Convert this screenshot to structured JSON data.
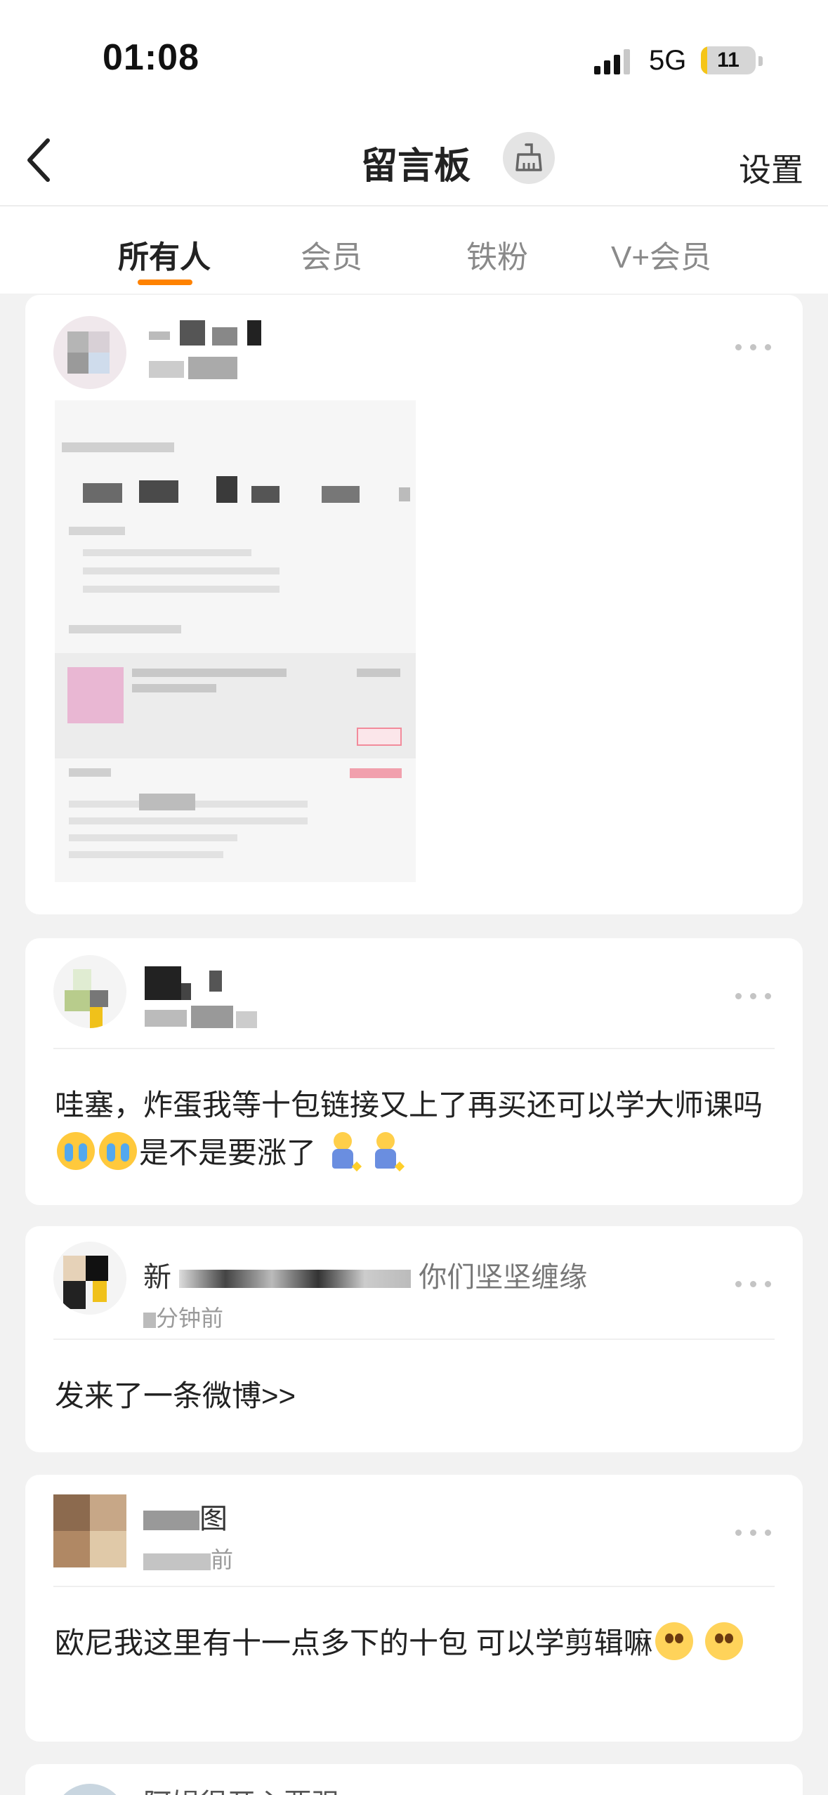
{
  "status_bar": {
    "time": "01:08",
    "network": "5G",
    "battery": "11",
    "battery_level": 0.11
  },
  "nav": {
    "title": "留言板",
    "settings_label": "设置",
    "back_icon": "chevron-left-icon",
    "broom_icon": "broom-icon"
  },
  "tabs": [
    {
      "label": "所有人",
      "active": true
    },
    {
      "label": "会员",
      "active": false
    },
    {
      "label": "铁粉",
      "active": false
    },
    {
      "label": "V+会员",
      "active": false
    }
  ],
  "colors": {
    "accent": "#ff8200",
    "background": "#f2f2f2",
    "card": "#ffffff"
  },
  "posts": [
    {
      "type": "image"
    },
    {
      "text": "哇塞，炸蛋我等十包链接又上了再买还可以学大师课吗",
      "text2": "是不是要涨了"
    },
    {
      "username_partial": "新",
      "username_tail": "你们坚坚缠缘",
      "time_partial": "分钟前",
      "text": "发来了一条微博>>"
    },
    {
      "username_partial": "图",
      "time_partial": "前",
      "text": "欧尼我这里有十一点多下的十包 可以学剪辑嘛"
    },
    {
      "username_partial": "阿娟很开心要强"
    }
  ]
}
